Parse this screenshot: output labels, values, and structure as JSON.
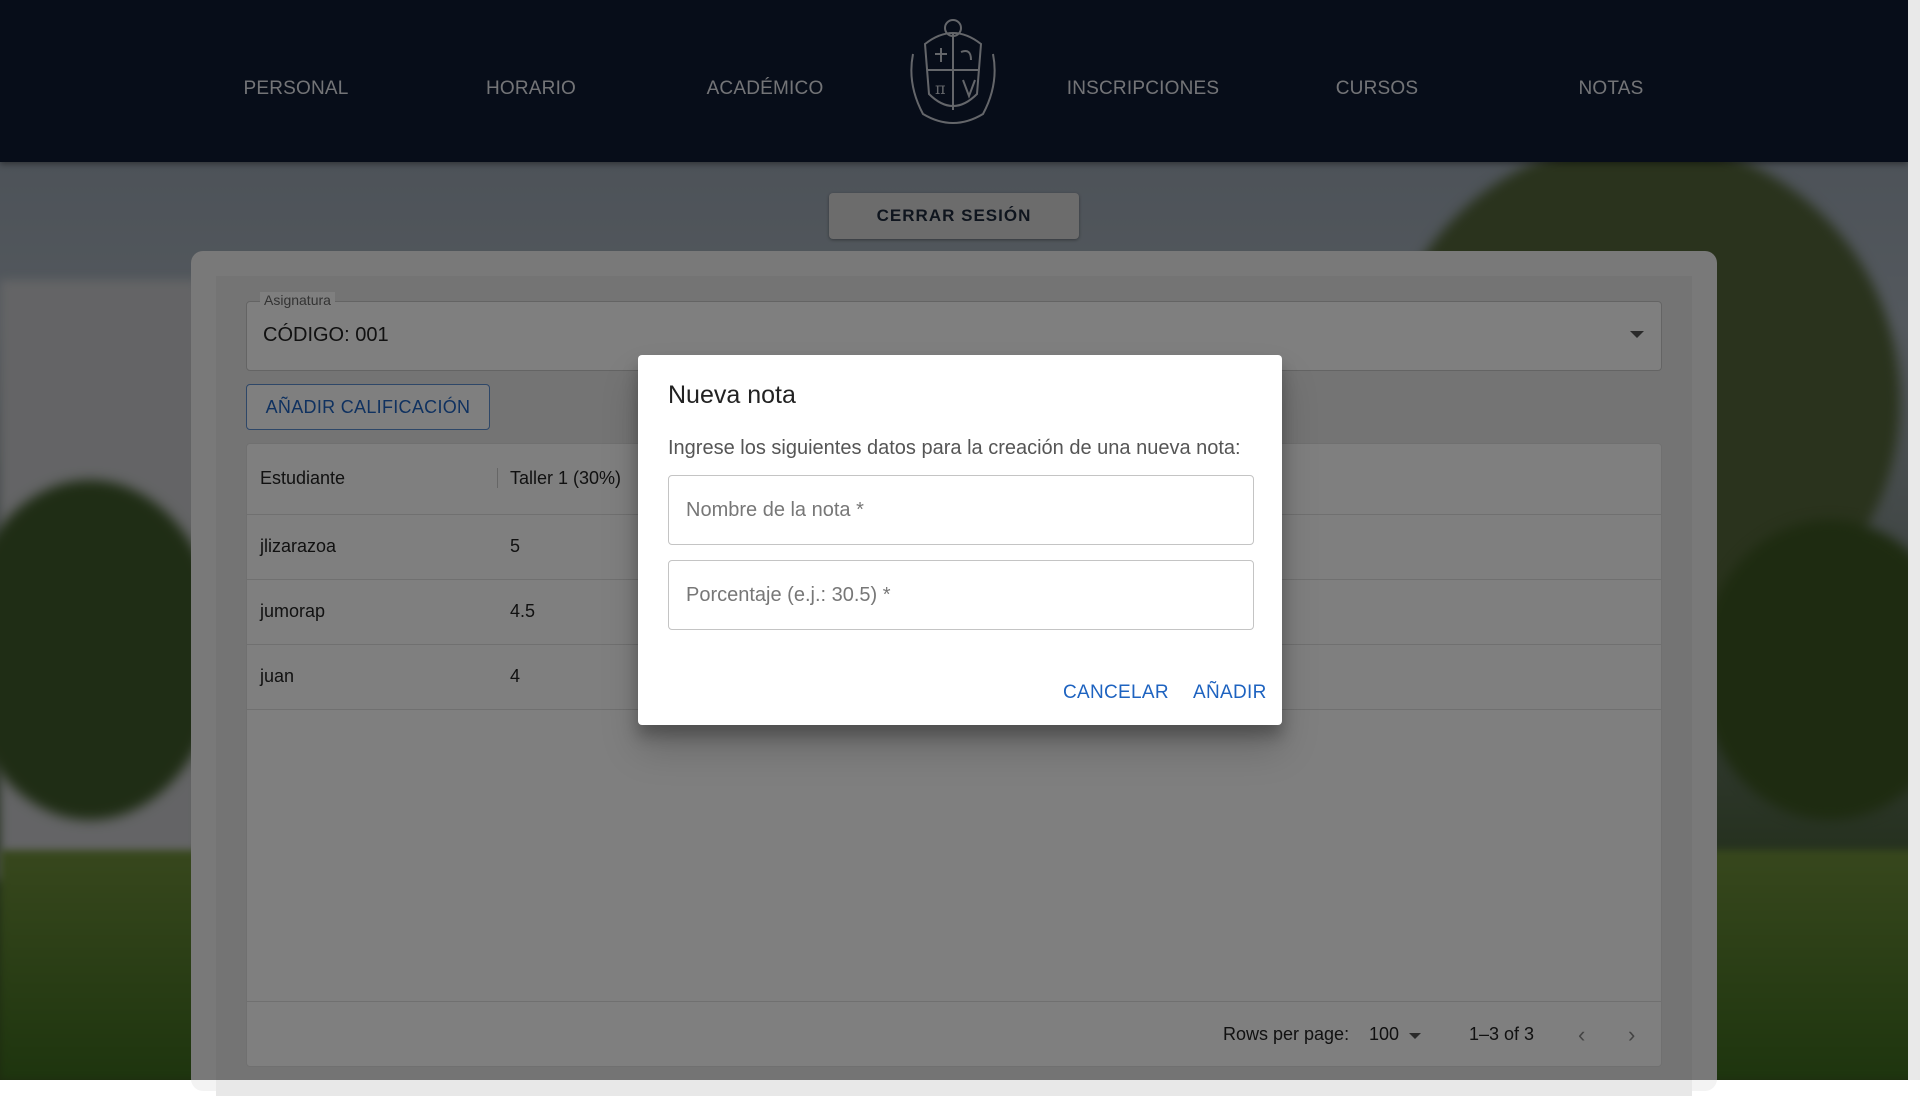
{
  "nav": {
    "items": [
      {
        "label": "PERSONAL"
      },
      {
        "label": "HORARIO"
      },
      {
        "label": "ACADÉMICO"
      },
      {
        "label": "INSCRIPCIONES"
      },
      {
        "label": "CURSOS"
      },
      {
        "label": "NOTAS"
      }
    ],
    "logo": "university-crest-icon"
  },
  "logout_label": "CERRAR SESIÓN",
  "subject": {
    "legend": "Asignatura",
    "value": "CÓDIGO: 001"
  },
  "add_grade_label": "AÑADIR CALIFICACIÓN",
  "grid": {
    "columns": [
      "Estudiante",
      "Taller 1 (30%)"
    ],
    "rows": [
      {
        "student": "jlizarazoa",
        "grade": "5"
      },
      {
        "student": "jumorap",
        "grade": "4.5"
      },
      {
        "student": "juan",
        "grade": "4"
      }
    ],
    "footer": {
      "rows_per_page_label": "Rows per page:",
      "rows_per_page_value": "100",
      "range": "1–3 of 3"
    }
  },
  "dialog": {
    "title": "Nueva nota",
    "text": "Ingrese los siguientes datos para la creación de una nueva nota:",
    "name_placeholder": "Nombre de la nota *",
    "percent_placeholder": "Porcentaje (e.j.: 30.5) *",
    "cancel_label": "CANCELAR",
    "add_label": "AÑADIR"
  },
  "colors": {
    "header": "#0f1a33",
    "accent": "#1e63c0"
  }
}
